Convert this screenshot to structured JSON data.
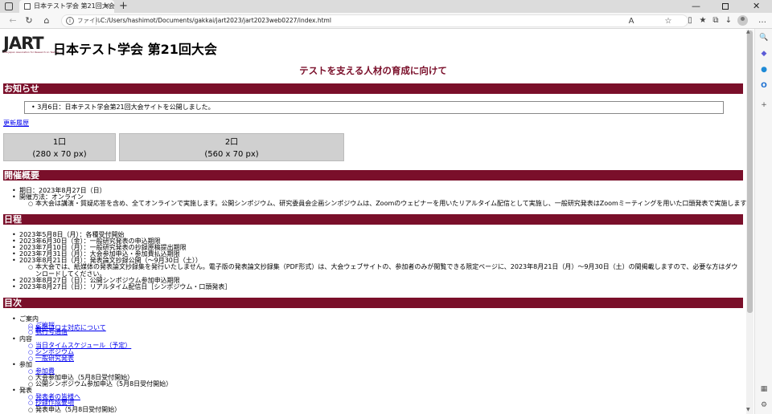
{
  "browser": {
    "tab_title": "日本テスト学会 第21回大会",
    "new_tab": "+",
    "close": "×",
    "minimize": "—",
    "win_close": "✕",
    "address_prefix": "ファイル",
    "address_url": "C:/Users/hashimot/Documents/gakkai/jart2023/jart2023web0227/index.html",
    "icons": [
      "back-icon",
      "refresh-icon",
      "home-icon",
      "read-aloud-icon",
      "favorite-icon",
      "split-screen-icon",
      "favorites-icon",
      "collections-icon",
      "downloads-icon",
      "profile-icon"
    ]
  },
  "glyphs": {
    "back": "←",
    "refresh": "↻",
    "home": "⌂",
    "info": "i",
    "read_aloud": "A",
    "favorite": "☆",
    "split": "▯",
    "favorites": "★",
    "collections": "⧉",
    "downloads": "↓",
    "more": "…",
    "search": "🔍",
    "add": "+",
    "settings": "⚙",
    "layout": "▦",
    "scroll_up": "▲",
    "scroll_down": "▼"
  },
  "header": {
    "logo": "JART",
    "logo_sub": "The Japan Association for Research on Testing",
    "title": "日本テスト学会 第21回大会",
    "subtitle": "テストを支える人材の育成に向けて"
  },
  "news": {
    "heading": "お知らせ",
    "items": [
      "3月6日：日本テスト学会第21回大会サイトを公開しました。"
    ],
    "history_link": "更新履歴"
  },
  "banners": [
    {
      "line1": "1口",
      "line2": "(280 x 70 px)"
    },
    {
      "line1": "2口",
      "line2": "(560 x 70 px)"
    }
  ],
  "overview": {
    "heading": "開催概要",
    "items": [
      "期日：2023年8月27日（日）",
      "開催方法：オンライン"
    ],
    "sub": "本大会は講演・質疑応答を含め、全てオンラインで実施します。公開シンポジウム、研究委員会企画シンポジウムは、Zoomのウェビナーを用いたリアルタイム配信として実施し、一般研究発表はZoomミーティングを用いた口頭発表で実施します。"
  },
  "schedule": {
    "heading": "日程",
    "items": [
      "2023年5月8日（月）：各種受付開始",
      "2023年6月30日（金）：一般研究発表の申込期限",
      "2023年7月10日（月）：一般研究発表の抄録原稿提出期限",
      "2023年7月31日（月）：大会参加申込・参加費払込期限",
      "2023年8月21日（月）：発表論文抄録公開（～9月30日（土））"
    ],
    "sub": "本大会では、紙媒体の発表論文抄録集を発行いたしません。電子版の発表論文抄録集（PDF形式）は、大会ウェブサイトの、参加者のみが閲覧できる限定ページに、2023年8月21日（月）～9月30日（土）の間掲載しますので、必要な方はダウンロードしてください。",
    "items2": [
      "2023年8月27日（日）：公開シンポジウム参加申込期限",
      "2023年8月27日（日）：リアルタイム配信日［シンポジウム・口頭発表］"
    ]
  },
  "toc": {
    "heading": "目次",
    "groups": [
      {
        "label": "ご案内",
        "items": [
          "ご挨拶",
          "新型コロナ対応について",
          "執行号通信"
        ]
      },
      {
        "label": "内容",
        "items": [
          "当日タイムスケジュール（予定）",
          "シンポジウム",
          "一般研究発表"
        ]
      },
      {
        "label": "参加",
        "items": [
          "参加費",
          "大会参加申込（5月8日受付開始）",
          "公開シンポジウム参加申込（5月8日受付開始）"
        ]
      },
      {
        "label": "発表",
        "items": [
          "発表者の皆様へ",
          "抄録作成要項",
          "発表申込（5月8日受付開始）"
        ]
      }
    ]
  }
}
